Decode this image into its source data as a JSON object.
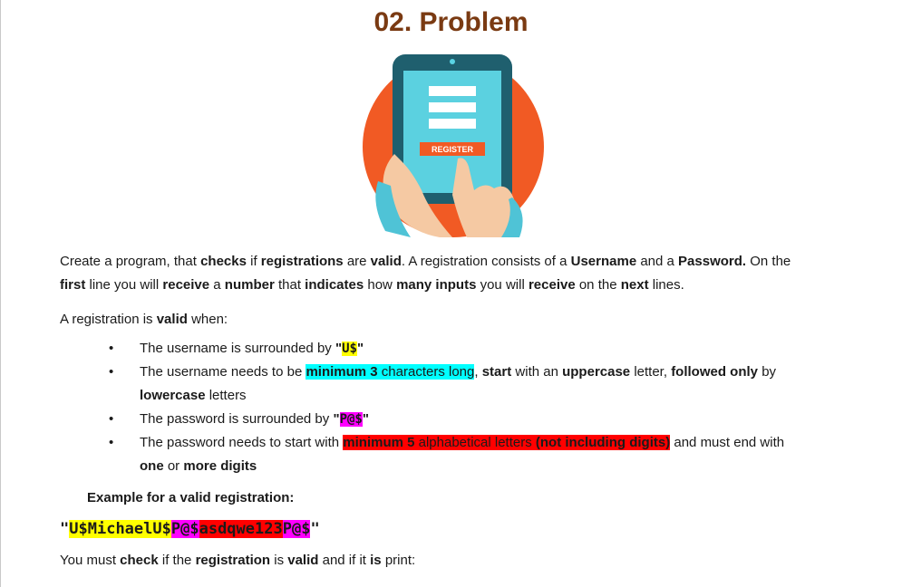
{
  "title": "02. Problem",
  "hero": {
    "button_label": "REGISTER"
  },
  "p1": [
    "Create a program, that ",
    "checks",
    " if ",
    "registrations",
    " are ",
    "valid",
    ". A registration consists of a ",
    "Username",
    " and a ",
    "Password.",
    " On the ",
    "first",
    " line you will ",
    "receive",
    " a ",
    "number",
    " that ",
    "indicates",
    " how ",
    "many inputs",
    " you will ",
    "receive",
    " on the ",
    "next",
    " lines."
  ],
  "p2": [
    "A registration is ",
    "valid",
    " when:"
  ],
  "rules": {
    "r1": [
      "The username is surrounded by ",
      "\"",
      "U$",
      "\""
    ],
    "r2": [
      "The username needs to be ",
      "minimum 3",
      " characters long",
      ", ",
      "start",
      " with an ",
      "uppercase",
      " letter, ",
      "followed only",
      " by ",
      "lowercase",
      " letters"
    ],
    "r3": [
      "The password is surrounded by ",
      "\"",
      "P@$",
      "\""
    ],
    "r4": [
      "The password needs to start with ",
      "minimum 5",
      " alphabetical letters ",
      "(not including digits)",
      " and must end with ",
      "one",
      " or ",
      "more digits"
    ]
  },
  "example_label": "Example for a valid registration:",
  "example_parts": [
    "\"",
    "U$",
    "Michael",
    "U$",
    "P@$",
    "asdqwe123",
    "P@$",
    "\""
  ],
  "p3": [
    "You must ",
    "check",
    " if the ",
    "registration",
    " is ",
    "valid",
    " and if it ",
    "is",
    " print:"
  ],
  "colors": {
    "title": "#7a3a12",
    "yellow": "#ffff00",
    "cyan": "#00ffff",
    "magenta": "#ff00ff",
    "red": "#ff0000"
  }
}
